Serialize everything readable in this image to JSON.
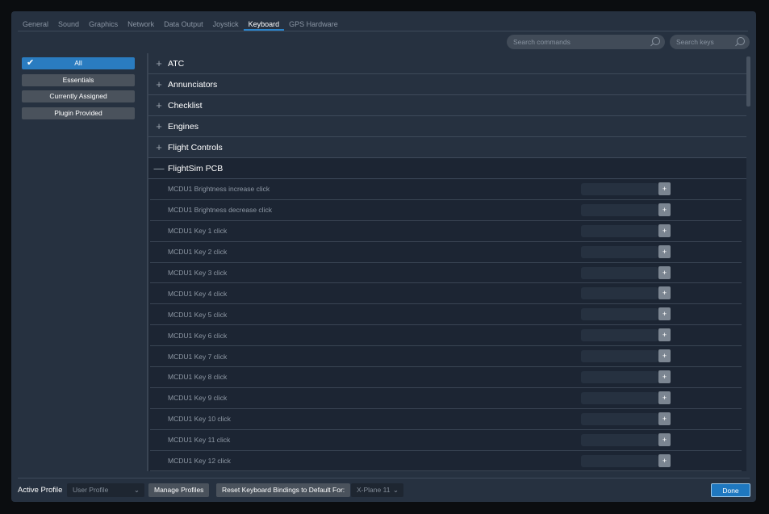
{
  "tabs": [
    "General",
    "Sound",
    "Graphics",
    "Network",
    "Data Output",
    "Joystick",
    "Keyboard",
    "GPS Hardware"
  ],
  "active_tab": "Keyboard",
  "search_commands_placeholder": "Search commands",
  "search_keys_placeholder": "Search keys",
  "filters": [
    "All",
    "Essentials",
    "Currently Assigned",
    "Plugin Provided"
  ],
  "active_filter": "All",
  "categories": [
    "ATC",
    "Annunciators",
    "Checklist",
    "Engines",
    "Flight Controls"
  ],
  "expanded_category": "FlightSim PCB",
  "commands": [
    "MCDU1 Brightness increase click",
    "MCDU1 Brightness decrease click",
    "MCDU1 Key 1 click",
    "MCDU1 Key 2 click",
    "MCDU1 Key 3 click",
    "MCDU1 Key 4 click",
    "MCDU1 Key 5 click",
    "MCDU1 Key 6 click",
    "MCDU1 Key 7 click",
    "MCDU1 Key 8 click",
    "MCDU1 Key 9 click",
    "MCDU1 Key 10 click",
    "MCDU1 Key 11 click",
    "MCDU1 Key 12 click"
  ],
  "add_binding_label": "+",
  "footer": {
    "active_profile_label": "Active Profile",
    "profile_value": "User Profile",
    "manage_profiles": "Manage Profiles",
    "reset_label": "Reset Keyboard Bindings to Default For:",
    "reset_value": "X-Plane 11",
    "done": "Done"
  },
  "colors": {
    "accent": "#2a82c8",
    "panel": "#263140"
  }
}
